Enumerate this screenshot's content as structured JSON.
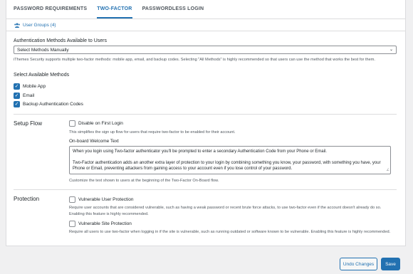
{
  "tabs": [
    {
      "label": "PASSWORD REQUIREMENTS"
    },
    {
      "label": "TWO-FACTOR"
    },
    {
      "label": "PASSWORDLESS LOGIN"
    }
  ],
  "user_groups": {
    "label": "User Groups (4)",
    "icon": "users-icon"
  },
  "auth_methods": {
    "label": "Authentication Methods Available to Users",
    "selected": "Select Methods Manually",
    "help": "iThemes Security supports multiple two-factor methods: mobile app, email, and backup codes. Selecting \"All Methods\" is highly recommended so that users can use the method that works the best for them."
  },
  "available_methods": {
    "label": "Select Available Methods",
    "options": [
      {
        "label": "Mobile App",
        "checked": true
      },
      {
        "label": "Email",
        "checked": true
      },
      {
        "label": "Backup Authentication Codes",
        "checked": true
      }
    ]
  },
  "setup_flow": {
    "section_label": "Setup Flow",
    "disable_label": "Disable on First Login",
    "disable_checked": false,
    "disable_help": "This simplifies the sign up flow for users that require two-factor to be enabled for their account.",
    "welcome_label": "On-board Welcome Text",
    "welcome_p1": "When you login using Two-factor authenticator you'll be prompted to enter a secondary Authentication Code from your Phone or Email.",
    "welcome_p2": "Two-Factor authentication adds an another extra layer of protection to your login by combining something you know, your password, with something you have, your Phone or Email, preventing attackers from gaining access to your account even if you lose control of your password.",
    "welcome_help": "Customize the text shown to users at the beginning of the Two-Factor On-Board flow."
  },
  "protection": {
    "section_label": "Protection",
    "vuln_user_label": "Vulnerable User Protection",
    "vuln_user_checked": false,
    "vuln_user_help": "Require user accounts that are considered vulnerable, such as having a weak password or recent brute force attacks, to use two-factor even if the account doesn't already do so. Enabling this feature is highly recommended.",
    "vuln_site_label": "Vulnerable Site Protection",
    "vuln_site_checked": false,
    "vuln_site_help": "Require all users to use two-factor when logging in if the site is vulnerable, such as running outdated or software known to be vulnerable. Enabling this feature is highly recommended."
  },
  "footer": {
    "undo_label": "Undo Changes",
    "save_label": "Save"
  },
  "colors": {
    "accent": "#2271b1",
    "background": "#f0f0f1",
    "card": "#ffffff"
  }
}
